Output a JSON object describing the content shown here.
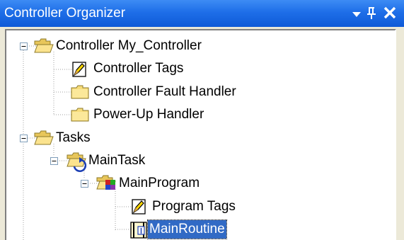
{
  "window": {
    "title": "Controller Organizer",
    "menu_icon": "dropdown-arrow-icon",
    "pin_icon": "pin-icon",
    "close_icon": "close-icon"
  },
  "tree": {
    "nodes": [
      {
        "label": "Controller My_Controller",
        "icon": "folder-open-icon",
        "expanded": true
      },
      {
        "label": "Controller Tags",
        "icon": "tags-icon"
      },
      {
        "label": "Controller Fault Handler",
        "icon": "folder-icon"
      },
      {
        "label": "Power-Up Handler",
        "icon": "folder-icon"
      },
      {
        "label": "Tasks",
        "icon": "folder-open-icon",
        "expanded": true
      },
      {
        "label": "MainTask",
        "icon": "task-icon",
        "expanded": true
      },
      {
        "label": "MainProgram",
        "icon": "program-icon",
        "expanded": true
      },
      {
        "label": "Program Tags",
        "icon": "tags-icon"
      },
      {
        "label": "MainRoutine",
        "icon": "routine-icon",
        "selected": true
      }
    ]
  },
  "colors": {
    "title_bar": "#1e6ee8",
    "selection": "#316ac5",
    "folder": "#f5d76e",
    "panel": "#ece9d8"
  }
}
